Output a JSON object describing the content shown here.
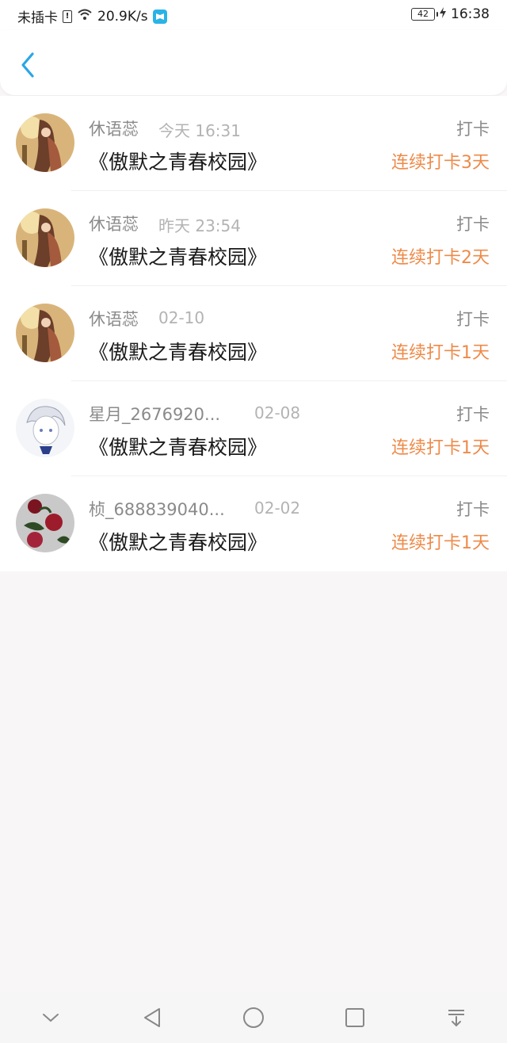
{
  "status_bar": {
    "carrier": "未插卡",
    "speed": "20.9K/s",
    "battery": "42",
    "time": "16:38",
    "icons": [
      "sim-alert-icon",
      "wifi-icon",
      "reader-app-icon",
      "battery-icon",
      "charging-icon"
    ]
  },
  "header": {
    "back_icon": "chevron-left-icon",
    "accent_color": "#2ba6e6"
  },
  "colors": {
    "streak": "#ee8a48",
    "name": "#8a8a8a",
    "time": "#b3b3b3",
    "title": "#1a1a1a"
  },
  "records": [
    {
      "name": "休语蕊",
      "time": "今天 16:31",
      "book": "《傲默之青春校园》",
      "tag": "打卡",
      "streak": "连续打卡3天",
      "avatar": "anime-girl-avatar"
    },
    {
      "name": "休语蕊",
      "time": "昨天 23:54",
      "book": "《傲默之青春校园》",
      "tag": "打卡",
      "streak": "连续打卡2天",
      "avatar": "anime-girl-avatar"
    },
    {
      "name": "休语蕊",
      "time": "02-10",
      "book": "《傲默之青春校园》",
      "tag": "打卡",
      "streak": "连续打卡1天",
      "avatar": "anime-girl-avatar"
    },
    {
      "name": "星月_2676920...",
      "time": "02-08",
      "book": "《傲默之青春校园》",
      "tag": "打卡",
      "streak": "连续打卡1天",
      "avatar": "sketch-boy-avatar"
    },
    {
      "name": "桢_688839040...",
      "time": "02-02",
      "book": "《傲默之青春校园》",
      "tag": "打卡",
      "streak": "连续打卡1天",
      "avatar": "roses-avatar"
    }
  ],
  "nav_bar": {
    "icons": [
      "collapse-icon",
      "back-triangle-icon",
      "home-circle-icon",
      "recents-square-icon",
      "notification-pull-icon"
    ]
  }
}
